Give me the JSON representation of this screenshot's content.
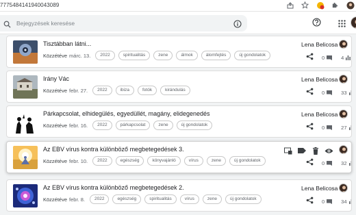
{
  "browser": {
    "url_fragment": "7775484141940043089"
  },
  "header": {
    "search_placeholder": "Bejegyzések keresése"
  },
  "icons": {
    "search": "search-icon",
    "info": "info-icon",
    "help": "help-icon",
    "apps": "apps-grid-icon",
    "share": "share-icon",
    "comment": "comment-icon",
    "views": "bar-chart-icon",
    "edit_layout": "layout-icon",
    "label": "label-icon",
    "delete": "trash-icon",
    "preview": "eye-icon"
  },
  "posts": [
    {
      "title": "Tisztábban látni...",
      "published_label": "Közzétéve",
      "date": "márc. 13.",
      "labels": [
        "2022",
        "spiritualitás",
        "zene",
        "álmok",
        "álomfejtés",
        "új gondolatok"
      ],
      "author": "Lena Belicosa",
      "comments": "0",
      "views": "4"
    },
    {
      "title": "Irány Vác",
      "published_label": "Közzétéve",
      "date": "febr. 27.",
      "labels": [
        "2022",
        "ibiza",
        "fotók",
        "kirándulás"
      ],
      "author": "Lena Belicosa",
      "comments": "0",
      "views": "33"
    },
    {
      "title": "Párkapcsolat, elhidegülés, egyedüllét, magány, elidegenedés",
      "published_label": "Közzétéve",
      "date": "febr. 16.",
      "labels": [
        "2022",
        "párkapcsolat",
        "zene",
        "új gondolatok"
      ],
      "author": "Lena Belicosa",
      "comments": "0",
      "views": "27"
    },
    {
      "title": "Az EBV vírus kontra különböző megbetegedések 3.",
      "published_label": "Közzétéve",
      "date": "febr. 10.",
      "labels": [
        "2022",
        "egészség",
        "könyvajánló",
        "vírus",
        "zene",
        "új gondolatok"
      ],
      "author": "",
      "comments": "0",
      "views": "32"
    },
    {
      "title": "Az EBV vírus kontra különböző megbetegedések 2.",
      "published_label": "Közzétéve",
      "date": "febr. 8.",
      "labels": [
        "2022",
        "egészség",
        "spiritualitás",
        "vírus",
        "zene",
        "új gondolatok"
      ],
      "author": "Lena Belicosa",
      "comments": "0",
      "views": "34"
    }
  ]
}
